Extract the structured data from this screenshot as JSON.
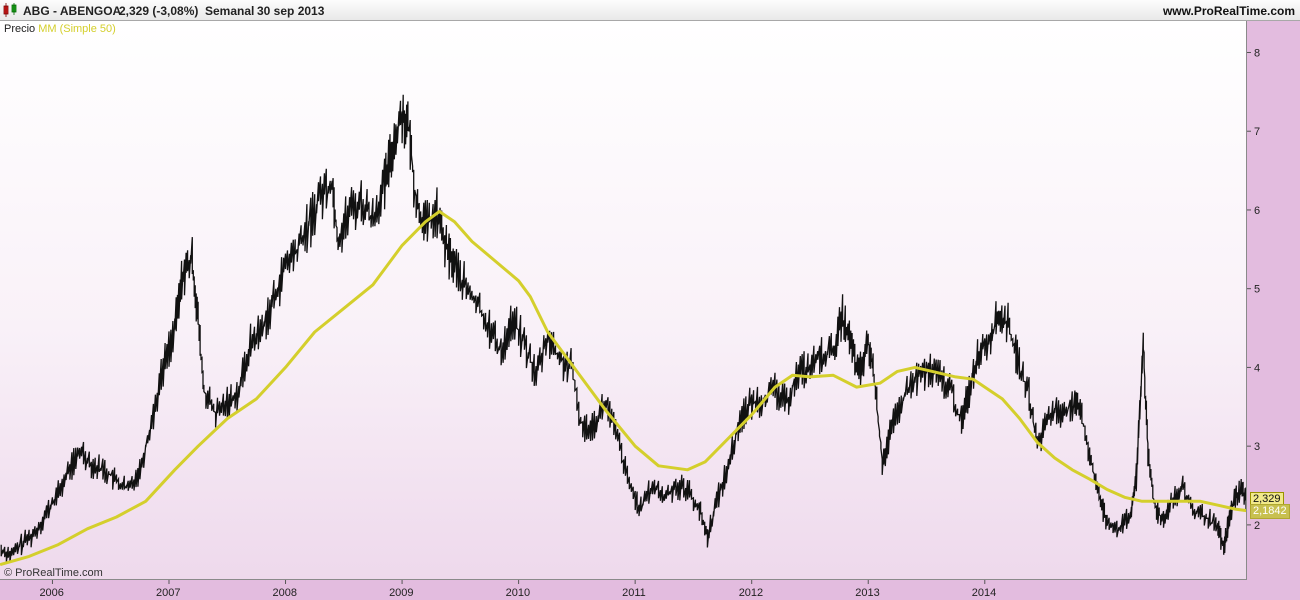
{
  "header": {
    "symbol": "ABG - ABENGOA",
    "last_price": "2,329 (-3,08%)",
    "period": "Semanal",
    "date": "30 sep 2013",
    "site": "www.ProRealTime.com"
  },
  "legend": {
    "price_label": "Precio",
    "ma_label": "MM (Simple 50)"
  },
  "watermark": "© ProRealTime.com",
  "badges": {
    "price": "2,329",
    "ma": "2,1842"
  },
  "colors": {
    "price": "#111111",
    "ma": "#d4cf2c",
    "plot_bg_top": "#ffffff",
    "plot_bg_bottom": "#eed9ec",
    "frame": "#e3bcdf"
  },
  "chart_data": {
    "type": "line",
    "title": "",
    "xlabel": "",
    "ylabel": "",
    "ylim": [
      1.3,
      8.4
    ],
    "xlim": [
      2005.55,
      2016.25
    ],
    "grid": false,
    "legend_position": "top-left",
    "y_ticks": [
      "2",
      "3",
      "4",
      "5",
      "6",
      "7",
      "8"
    ],
    "x_ticks": [
      {
        "label": "2006",
        "year": 2006
      },
      {
        "label": "2007",
        "year": 2007
      },
      {
        "label": "2008",
        "year": 2008
      },
      {
        "label": "2009",
        "year": 2009
      },
      {
        "label": "2010",
        "year": 2010
      },
      {
        "label": "2011",
        "year": 2011
      },
      {
        "label": "2012",
        "year": 2012
      },
      {
        "label": "2013",
        "year": 2013
      },
      {
        "label": "2014",
        "year": 2014
      }
    ],
    "series": [
      {
        "name": "Precio",
        "points": [
          [
            2005.56,
            1.68
          ],
          [
            2005.65,
            1.62
          ],
          [
            2005.75,
            1.78
          ],
          [
            2005.85,
            1.9
          ],
          [
            2005.95,
            2.15
          ],
          [
            2006.05,
            2.4
          ],
          [
            2006.15,
            2.72
          ],
          [
            2006.25,
            2.95
          ],
          [
            2006.35,
            2.75
          ],
          [
            2006.45,
            2.7
          ],
          [
            2006.55,
            2.55
          ],
          [
            2006.65,
            2.45
          ],
          [
            2006.75,
            2.7
          ],
          [
            2006.85,
            3.3
          ],
          [
            2006.95,
            4.0
          ],
          [
            2007.05,
            4.5
          ],
          [
            2007.12,
            5.2
          ],
          [
            2007.2,
            5.35
          ],
          [
            2007.25,
            4.6
          ],
          [
            2007.3,
            3.7
          ],
          [
            2007.4,
            3.4
          ],
          [
            2007.5,
            3.55
          ],
          [
            2007.6,
            3.7
          ],
          [
            2007.7,
            4.3
          ],
          [
            2007.8,
            4.5
          ],
          [
            2007.9,
            4.85
          ],
          [
            2008.0,
            5.3
          ],
          [
            2008.1,
            5.5
          ],
          [
            2008.2,
            5.8
          ],
          [
            2008.3,
            6.2
          ],
          [
            2008.4,
            6.35
          ],
          [
            2008.45,
            5.6
          ],
          [
            2008.55,
            6.0
          ],
          [
            2008.65,
            6.1
          ],
          [
            2008.75,
            5.9
          ],
          [
            2008.85,
            6.3
          ],
          [
            2008.92,
            6.8
          ],
          [
            2009.0,
            7.25
          ],
          [
            2009.06,
            7.0
          ],
          [
            2009.12,
            6.1
          ],
          [
            2009.2,
            5.8
          ],
          [
            2009.3,
            5.95
          ],
          [
            2009.38,
            5.5
          ],
          [
            2009.45,
            5.3
          ],
          [
            2009.55,
            5.0
          ],
          [
            2009.65,
            4.8
          ],
          [
            2009.75,
            4.5
          ],
          [
            2009.85,
            4.2
          ],
          [
            2009.95,
            4.6
          ],
          [
            2010.05,
            4.3
          ],
          [
            2010.15,
            3.9
          ],
          [
            2010.25,
            4.4
          ],
          [
            2010.35,
            4.1
          ],
          [
            2010.45,
            4.0
          ],
          [
            2010.55,
            3.2
          ],
          [
            2010.65,
            3.3
          ],
          [
            2010.75,
            3.55
          ],
          [
            2010.85,
            3.1
          ],
          [
            2010.95,
            2.5
          ],
          [
            2011.05,
            2.2
          ],
          [
            2011.15,
            2.5
          ],
          [
            2011.25,
            2.35
          ],
          [
            2011.35,
            2.5
          ],
          [
            2011.45,
            2.45
          ],
          [
            2011.55,
            2.2
          ],
          [
            2011.62,
            1.85
          ],
          [
            2011.7,
            2.3
          ],
          [
            2011.8,
            2.75
          ],
          [
            2011.9,
            3.35
          ],
          [
            2012.0,
            3.55
          ],
          [
            2012.1,
            3.6
          ],
          [
            2012.2,
            3.7
          ],
          [
            2012.3,
            3.55
          ],
          [
            2012.4,
            3.95
          ],
          [
            2012.5,
            4.0
          ],
          [
            2012.6,
            4.15
          ],
          [
            2012.7,
            4.2
          ],
          [
            2012.78,
            4.65
          ],
          [
            2012.85,
            4.3
          ],
          [
            2012.92,
            3.9
          ],
          [
            2013.0,
            4.3
          ],
          [
            2013.05,
            3.9
          ],
          [
            2013.12,
            2.8
          ],
          [
            2013.2,
            3.2
          ],
          [
            2013.3,
            3.6
          ],
          [
            2013.4,
            3.85
          ],
          [
            2013.5,
            3.95
          ],
          [
            2013.6,
            3.9
          ],
          [
            2013.7,
            3.75
          ],
          [
            2013.8,
            3.3
          ],
          [
            2013.88,
            3.8
          ],
          [
            2013.95,
            4.2
          ],
          [
            2014.05,
            4.4
          ],
          [
            2014.12,
            4.65
          ],
          [
            2014.2,
            4.55
          ],
          [
            2014.28,
            4.1
          ],
          [
            2014.38,
            3.65
          ],
          [
            2014.45,
            3.0
          ],
          [
            2014.55,
            3.4
          ],
          [
            2014.65,
            3.45
          ],
          [
            2014.75,
            3.5
          ],
          [
            2014.82,
            3.45
          ],
          [
            2014.9,
            2.9
          ],
          [
            2014.98,
            2.35
          ],
          [
            2015.05,
            2.05
          ],
          [
            2015.15,
            1.95
          ],
          [
            2015.25,
            2.1
          ],
          [
            2015.3,
            2.6
          ],
          [
            2015.36,
            4.3
          ],
          [
            2015.4,
            2.9
          ],
          [
            2015.45,
            2.3
          ],
          [
            2015.52,
            2.05
          ],
          [
            2015.6,
            2.3
          ],
          [
            2015.7,
            2.45
          ],
          [
            2015.8,
            2.15
          ],
          [
            2015.9,
            2.1
          ],
          [
            2016.0,
            1.95
          ],
          [
            2016.05,
            1.7
          ],
          [
            2016.1,
            2.1
          ],
          [
            2016.15,
            2.35
          ],
          [
            2016.2,
            2.45
          ],
          [
            2016.25,
            2.33
          ]
        ]
      },
      {
        "name": "MM (Simple 50)",
        "points": [
          [
            2005.56,
            1.5
          ],
          [
            2005.8,
            1.6
          ],
          [
            2006.05,
            1.75
          ],
          [
            2006.3,
            1.95
          ],
          [
            2006.55,
            2.1
          ],
          [
            2006.8,
            2.3
          ],
          [
            2007.05,
            2.7
          ],
          [
            2007.25,
            3.0
          ],
          [
            2007.5,
            3.35
          ],
          [
            2007.75,
            3.6
          ],
          [
            2008.0,
            4.0
          ],
          [
            2008.25,
            4.45
          ],
          [
            2008.5,
            4.75
          ],
          [
            2008.75,
            5.05
          ],
          [
            2009.0,
            5.55
          ],
          [
            2009.2,
            5.85
          ],
          [
            2009.32,
            5.98
          ],
          [
            2009.45,
            5.85
          ],
          [
            2009.6,
            5.6
          ],
          [
            2009.8,
            5.35
          ],
          [
            2010.0,
            5.1
          ],
          [
            2010.1,
            4.9
          ],
          [
            2010.25,
            4.45
          ],
          [
            2010.5,
            3.95
          ],
          [
            2010.75,
            3.45
          ],
          [
            2011.0,
            3.0
          ],
          [
            2011.2,
            2.75
          ],
          [
            2011.45,
            2.7
          ],
          [
            2011.6,
            2.8
          ],
          [
            2011.8,
            3.1
          ],
          [
            2012.0,
            3.4
          ],
          [
            2012.2,
            3.75
          ],
          [
            2012.35,
            3.9
          ],
          [
            2012.5,
            3.88
          ],
          [
            2012.7,
            3.9
          ],
          [
            2012.9,
            3.75
          ],
          [
            2013.1,
            3.8
          ],
          [
            2013.25,
            3.95
          ],
          [
            2013.4,
            4.0
          ],
          [
            2013.55,
            3.95
          ],
          [
            2013.75,
            3.88
          ],
          [
            2013.9,
            3.85
          ],
          [
            2014.0,
            3.75
          ],
          [
            2014.15,
            3.6
          ],
          [
            2014.3,
            3.35
          ],
          [
            2014.45,
            3.05
          ],
          [
            2014.6,
            2.85
          ],
          [
            2014.75,
            2.7
          ],
          [
            2014.9,
            2.58
          ],
          [
            2015.05,
            2.45
          ],
          [
            2015.2,
            2.35
          ],
          [
            2015.35,
            2.3
          ],
          [
            2015.5,
            2.3
          ],
          [
            2015.7,
            2.3
          ],
          [
            2015.85,
            2.3
          ],
          [
            2016.0,
            2.25
          ],
          [
            2016.15,
            2.2
          ],
          [
            2016.25,
            2.18
          ]
        ]
      }
    ]
  }
}
